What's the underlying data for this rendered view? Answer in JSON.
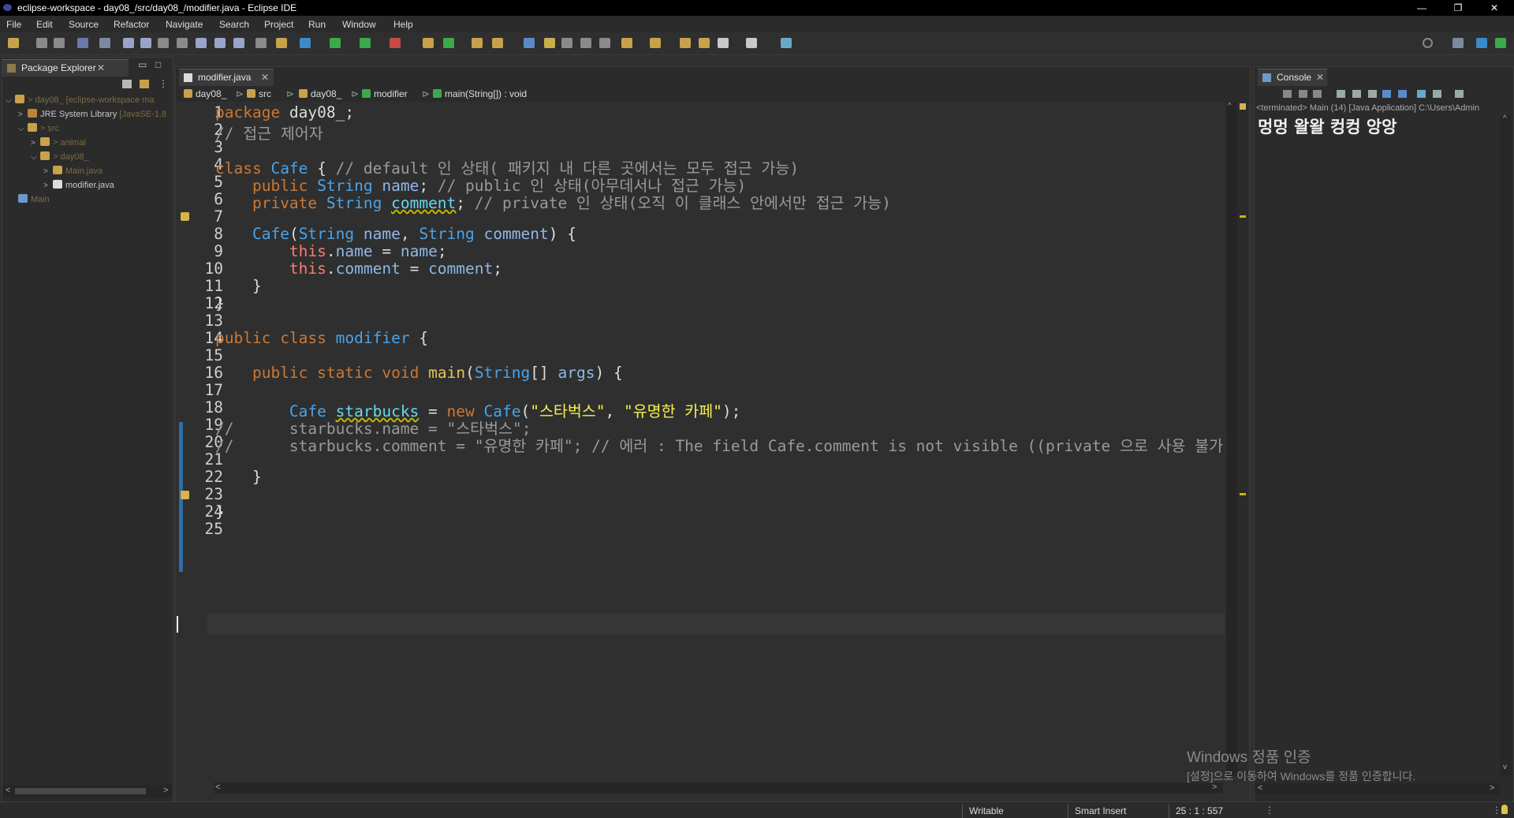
{
  "window": {
    "title": "eclipse-workspace - day08_/src/day08_/modifier.java - Eclipse IDE"
  },
  "menu": [
    "File",
    "Edit",
    "Source",
    "Refactor",
    "Navigate",
    "Search",
    "Project",
    "Run",
    "Window",
    "Help"
  ],
  "package_explorer": {
    "tab_label": "Package Explorer",
    "tree": [
      {
        "arrow": "⌵",
        "prefix": "> ",
        "name": "day08_",
        "suffix": " [eclipse-workspace ma"
      },
      {
        "arrow": ">",
        "prefix": "",
        "name": "JRE System Library",
        "suffix": " [JavaSE-1.8"
      },
      {
        "arrow": "⌵",
        "prefix": "> ",
        "name": "src",
        "suffix": ""
      },
      {
        "arrow": ">",
        "prefix": "> ",
        "name": "animal",
        "suffix": ""
      },
      {
        "arrow": "⌵",
        "prefix": "> ",
        "name": "day08_",
        "suffix": ""
      },
      {
        "arrow": ">",
        "prefix": "",
        "name": "Main.java",
        "suffix": ""
      },
      {
        "arrow": ">",
        "prefix": "",
        "name": "modifier.java",
        "suffix": ""
      },
      {
        "arrow": "",
        "prefix": "",
        "name": "Main",
        "suffix": ""
      }
    ]
  },
  "editor": {
    "tab_label": "modifier.java",
    "breadcrumbs": [
      "day08_",
      "src",
      "day08_",
      "modifier",
      "main(String[]) : void"
    ],
    "line_numbers": [
      "1",
      "2",
      "3",
      "4",
      "5",
      "6",
      "7",
      "8",
      "9",
      "10",
      "11",
      "12",
      "13",
      "14",
      "15",
      "16",
      "17",
      "18",
      "19",
      "20",
      "21",
      "22",
      "23",
      "24",
      "25"
    ],
    "lines": [
      "package day08_;",
      "// 접근 제어자",
      "",
      "class Cafe { // default 인 상태( 패키지 내 다른 곳에서는 모두 접근 가능)",
      "    public String name; // public 인 상태(아무데서나 접근 가능)",
      "    private String comment; // private 인 상태(오직 이 클래스 안에서만 접근 가능)",
      "",
      "    Cafe(String name, String comment) {",
      "        this.name = name;",
      "        this.comment = comment;",
      "    }",
      "}",
      "",
      "public class modifier {",
      "",
      "    public static void main(String[] args) {",
      "",
      "        Cafe starbucks = new Cafe(\"스타벅스\", \"유명한 카페\");",
      "//      starbucks.name = \"스타벅스\";",
      "//      starbucks.comment = \"유명한 카페\"; // 에러 : The field Cafe.comment is not visible ((private 으로 사용 불가)",
      "",
      "    }",
      "",
      "}",
      ""
    ]
  },
  "console": {
    "tab_label": "Console",
    "status_line": "<terminated> Main (14) [Java Application] C:\\Users\\Admin",
    "output": "멍멍 왈왈 컹컹 앙앙"
  },
  "statusbar": {
    "mode": "Writable",
    "insert": "Smart Insert",
    "position": "25 : 1 : 557"
  },
  "watermark": {
    "line1": "Windows 정품 인증",
    "line2": "[설정]으로 이동하여 Windows를 정품 인증합니다."
  }
}
